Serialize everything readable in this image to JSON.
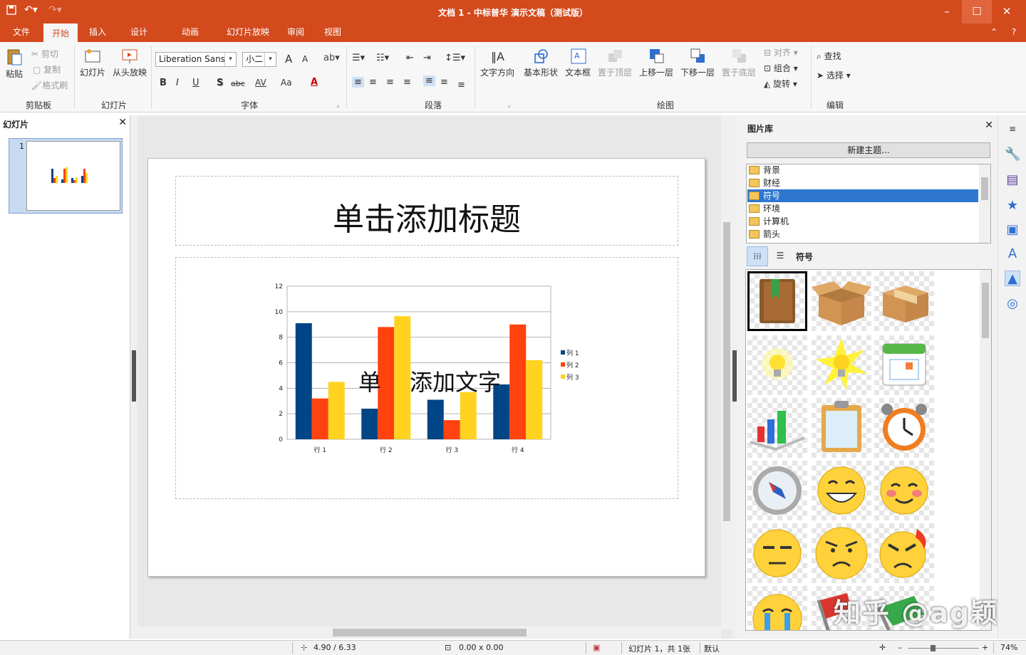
{
  "window": {
    "title": "文档 1 - 中标普华 演示文稿（测试版）"
  },
  "menu_tabs": [
    "文件",
    "开始",
    "插入",
    "设计",
    "动画",
    "幻灯片放映",
    "审阅",
    "视图"
  ],
  "active_tab": "开始",
  "ribbon": {
    "clipboard": {
      "paste": "粘贴",
      "cut": "剪切",
      "copy": "复制",
      "format_painter": "格式刷",
      "label": "剪贴板"
    },
    "slides": {
      "slide": "幻灯片",
      "from_start": "从头放映",
      "label": "幻灯片"
    },
    "font": {
      "family": "Liberation Sans",
      "size": "小二",
      "label": "字体",
      "bold": "B",
      "italic": "I",
      "underline": "U",
      "shadow": "S",
      "strike": "abc",
      "spacing": "AV",
      "case": "Aa",
      "color": "A",
      "grow": "A",
      "shrink": "A"
    },
    "paragraph": {
      "label": "段落"
    },
    "drawing": {
      "text_dir": "文字方向",
      "basic_shape": "基本形状",
      "textbox": "文本框",
      "to_front": "置于顶层",
      "forward": "上移一层",
      "backward": "下移一层",
      "to_back": "置于底层",
      "align": "对齐",
      "group": "组合",
      "rotate": "旋转",
      "label": "绘图"
    },
    "edit": {
      "find": "查找",
      "select": "选择",
      "label": "编辑"
    }
  },
  "slides_panel": {
    "title": "幻灯片",
    "slide_number": "1"
  },
  "slide": {
    "title_placeholder": "单击添加标题",
    "body_placeholder_left": "单",
    "body_placeholder_right": "添加文字"
  },
  "chart_data": {
    "type": "bar",
    "categories": [
      "行 1",
      "行 2",
      "行 3",
      "行 4"
    ],
    "series": [
      {
        "name": "列 1",
        "values": [
          9.1,
          2.4,
          3.1,
          4.3
        ],
        "color": "#004586"
      },
      {
        "name": "列 2",
        "values": [
          3.2,
          8.8,
          1.5,
          9.0
        ],
        "color": "#ff420e"
      },
      {
        "name": "列 3",
        "values": [
          4.5,
          9.65,
          3.7,
          6.2
        ],
        "color": "#ffd320"
      }
    ],
    "ylim": [
      0,
      12
    ],
    "yticks": [
      "0",
      "2",
      "4",
      "6",
      "8",
      "10",
      "12"
    ],
    "grid": true,
    "legend": "right"
  },
  "gallery": {
    "title": "图片库",
    "new_theme": "新建主题...",
    "categories": [
      "背景",
      "财经",
      "符号",
      "环境",
      "计算机",
      "箭头"
    ],
    "selected": "符号",
    "view_label": "符号",
    "items": [
      "book-icon",
      "open-box-icon",
      "closed-box-icon",
      "bulb-icon",
      "bright-bulb-icon",
      "calendar-icon",
      "bar-chart-icon",
      "clipboard-icon",
      "alarm-clock-icon",
      "compass-icon",
      "grin-emoji-icon",
      "blush-emoji-icon",
      "unamused-emoji-icon",
      "sad-emoji-icon",
      "angry-emoji-icon",
      "crying-emoji-icon",
      "flag-icon",
      "green-flag-icon"
    ]
  },
  "watermark": "知乎 @ag颖",
  "statusbar": {
    "position": "4.90 / 6.33",
    "size": "0.00 x 0.00",
    "slide_info": "幻灯片 1，共 1张",
    "layout": "默认",
    "zoom": "74%"
  }
}
